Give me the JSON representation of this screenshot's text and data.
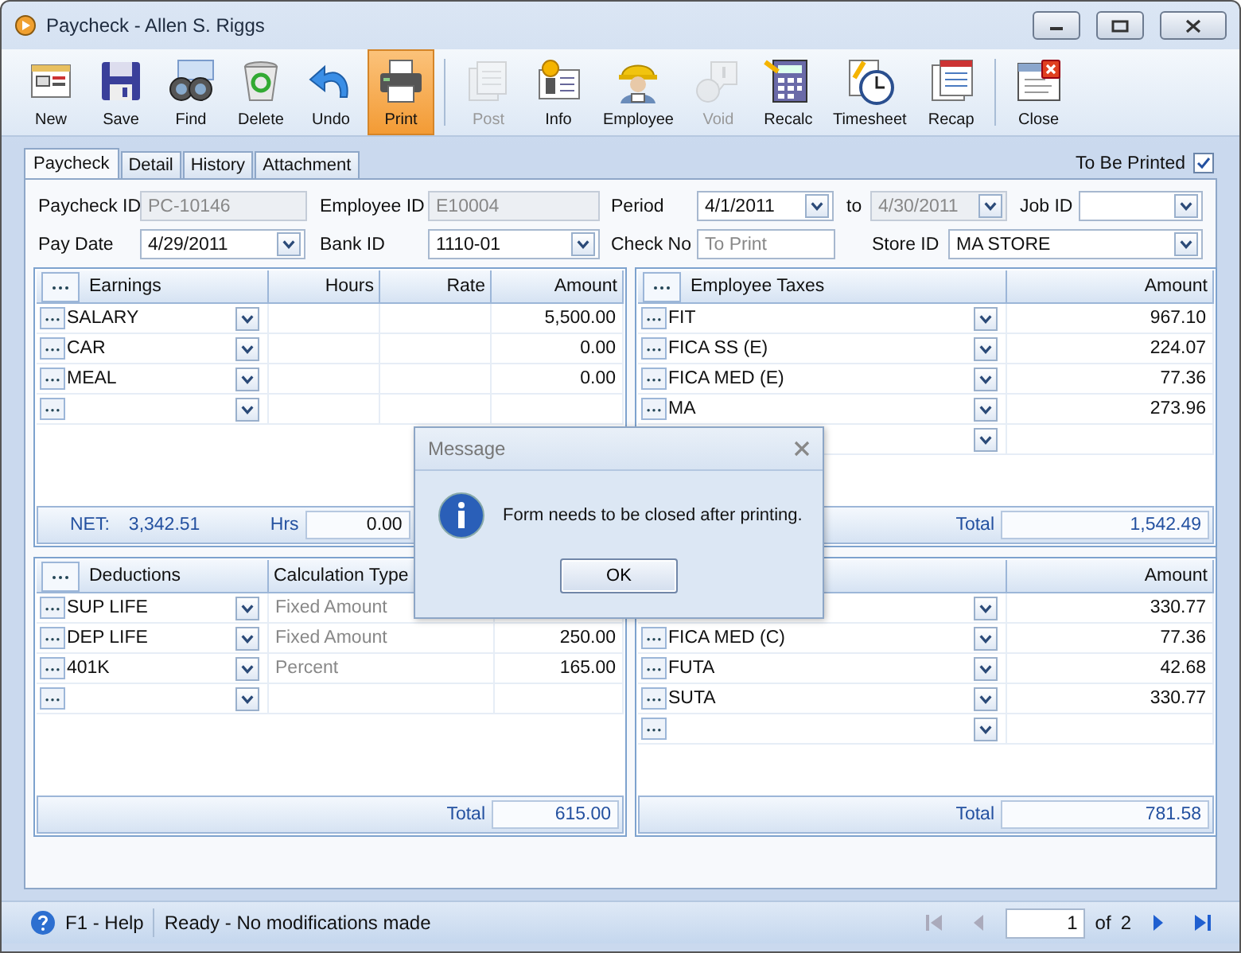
{
  "window": {
    "title": "Paycheck - Allen S. Riggs"
  },
  "toolbar": [
    {
      "label": "New",
      "disabled": false,
      "selected": false
    },
    {
      "label": "Save",
      "disabled": false,
      "selected": false
    },
    {
      "label": "Find",
      "disabled": false,
      "selected": false
    },
    {
      "label": "Delete",
      "disabled": false,
      "selected": false
    },
    {
      "label": "Undo",
      "disabled": false,
      "selected": false
    },
    {
      "label": "Print",
      "disabled": false,
      "selected": true
    },
    {
      "label": "Post",
      "disabled": true,
      "selected": false
    },
    {
      "label": "Info",
      "disabled": false,
      "selected": false
    },
    {
      "label": "Employee",
      "disabled": false,
      "selected": false
    },
    {
      "label": "Void",
      "disabled": true,
      "selected": false
    },
    {
      "label": "Recalc",
      "disabled": false,
      "selected": false
    },
    {
      "label": "Timesheet",
      "disabled": false,
      "selected": false
    },
    {
      "label": "Recap",
      "disabled": false,
      "selected": false
    },
    {
      "label": "Close",
      "disabled": false,
      "selected": false
    }
  ],
  "tabs": [
    {
      "label": "Paycheck",
      "selected": true
    },
    {
      "label": "Detail",
      "selected": false
    },
    {
      "label": "History",
      "selected": false
    },
    {
      "label": "Attachment",
      "selected": false
    }
  ],
  "to_be_printed": {
    "label": "To Be Printed",
    "checked": true
  },
  "form": {
    "fields": [
      {
        "label": "Paycheck ID",
        "kind": "text",
        "value": "PC-10146",
        "disabled": true
      },
      {
        "label": "Employee ID",
        "kind": "text",
        "value": "E10004",
        "disabled": true
      },
      {
        "label": "Period",
        "kind": "date",
        "value": "4/1/2011",
        "disabled": false
      },
      {
        "label": "to",
        "kind": "date",
        "value": "4/30/2011",
        "disabled": true
      },
      {
        "label": "Job ID",
        "kind": "combo"
      },
      {
        "label": "Pay Date",
        "kind": "date",
        "value": "4/29/2011",
        "disabled": false
      },
      {
        "label": "Bank ID",
        "kind": "combo",
        "value": "1110-01",
        "disabled": false
      },
      {
        "label": "Check No",
        "kind": "text",
        "placeholder": "To Print",
        "disabled": false
      },
      {
        "label": "Store ID",
        "kind": "combo",
        "value": "MA STORE",
        "disabled": false
      }
    ]
  },
  "grids": [
    {
      "title": "Earnings",
      "columns": [
        {
          "kind": "amount",
          "label": "Hours"
        },
        {
          "kind": "amount",
          "label": "Rate"
        },
        {
          "kind": "amount",
          "label": "Amount"
        }
      ],
      "rows": [
        {
          "kind": "item",
          "name": "SALARY",
          "amount": "5,500.00"
        },
        {
          "kind": "item",
          "name": "CAR",
          "amount": "0.00"
        },
        {
          "kind": "item",
          "name": "MEAL",
          "amount": "0.00"
        },
        {
          "kind": "new"
        }
      ],
      "footer": [
        {
          "kind": "label",
          "text": "NET:"
        },
        {
          "kind": "value",
          "text": "3,342.51"
        },
        {
          "kind": "label",
          "text": "Hrs"
        },
        {
          "kind": "field",
          "text": "0.00"
        }
      ]
    },
    {
      "title": "Employee Taxes",
      "columns": [
        {
          "kind": "amount",
          "label": "Amount"
        }
      ],
      "rows": [
        {
          "kind": "item",
          "name": "FIT",
          "amount": "967.10"
        },
        {
          "kind": "item",
          "name": "FICA SS (E)",
          "amount": "224.07"
        },
        {
          "kind": "item",
          "name": "FICA MED (E)",
          "amount": "77.36"
        },
        {
          "kind": "item",
          "name": "MA",
          "amount": "273.96"
        },
        {
          "kind": "new"
        }
      ],
      "footer": [
        {
          "kind": "label",
          "text": "Total"
        },
        {
          "kind": "field",
          "text": "1,542.49"
        }
      ]
    },
    {
      "title": "Deductions",
      "columns": [
        {
          "kind": "text",
          "label": "Calculation Type"
        },
        {
          "kind": "amount"
        }
      ],
      "rows": [
        {
          "kind": "item",
          "name": "SUP LIFE",
          "calculation_type": "Fixed Amount"
        },
        {
          "kind": "item",
          "name": "DEP LIFE",
          "calculation_type": "Fixed Amount",
          "column_3": "250.00"
        },
        {
          "kind": "item",
          "name": "401K",
          "calculation_type": "Percent",
          "column_3": "165.00"
        },
        {
          "kind": "new"
        }
      ],
      "footer": [
        {
          "kind": "label",
          "text": "Total"
        },
        {
          "kind": "field",
          "text": "615.00"
        }
      ]
    },
    {
      "columns": [
        {
          "kind": "amount",
          "label": "Amount"
        }
      ],
      "rows": [
        {
          "kind": "item",
          "amount": "330.77"
        },
        {
          "kind": "item",
          "name": "FICA MED (C)",
          "amount": "77.36"
        },
        {
          "kind": "item",
          "name": "FUTA",
          "amount": "42.68"
        },
        {
          "kind": "item",
          "name": "SUTA",
          "amount": "330.77"
        },
        {
          "kind": "new"
        }
      ],
      "footer": [
        {
          "kind": "label",
          "text": "Total"
        },
        {
          "kind": "field",
          "text": "781.58"
        }
      ]
    }
  ],
  "dialog": {
    "title": "Message",
    "message": "Form needs to be closed after printing.",
    "button": "OK"
  },
  "status_bar": {
    "help": "F1 - Help",
    "status": "Ready - No modifications made",
    "page": "1",
    "of": "of",
    "total": "2"
  }
}
